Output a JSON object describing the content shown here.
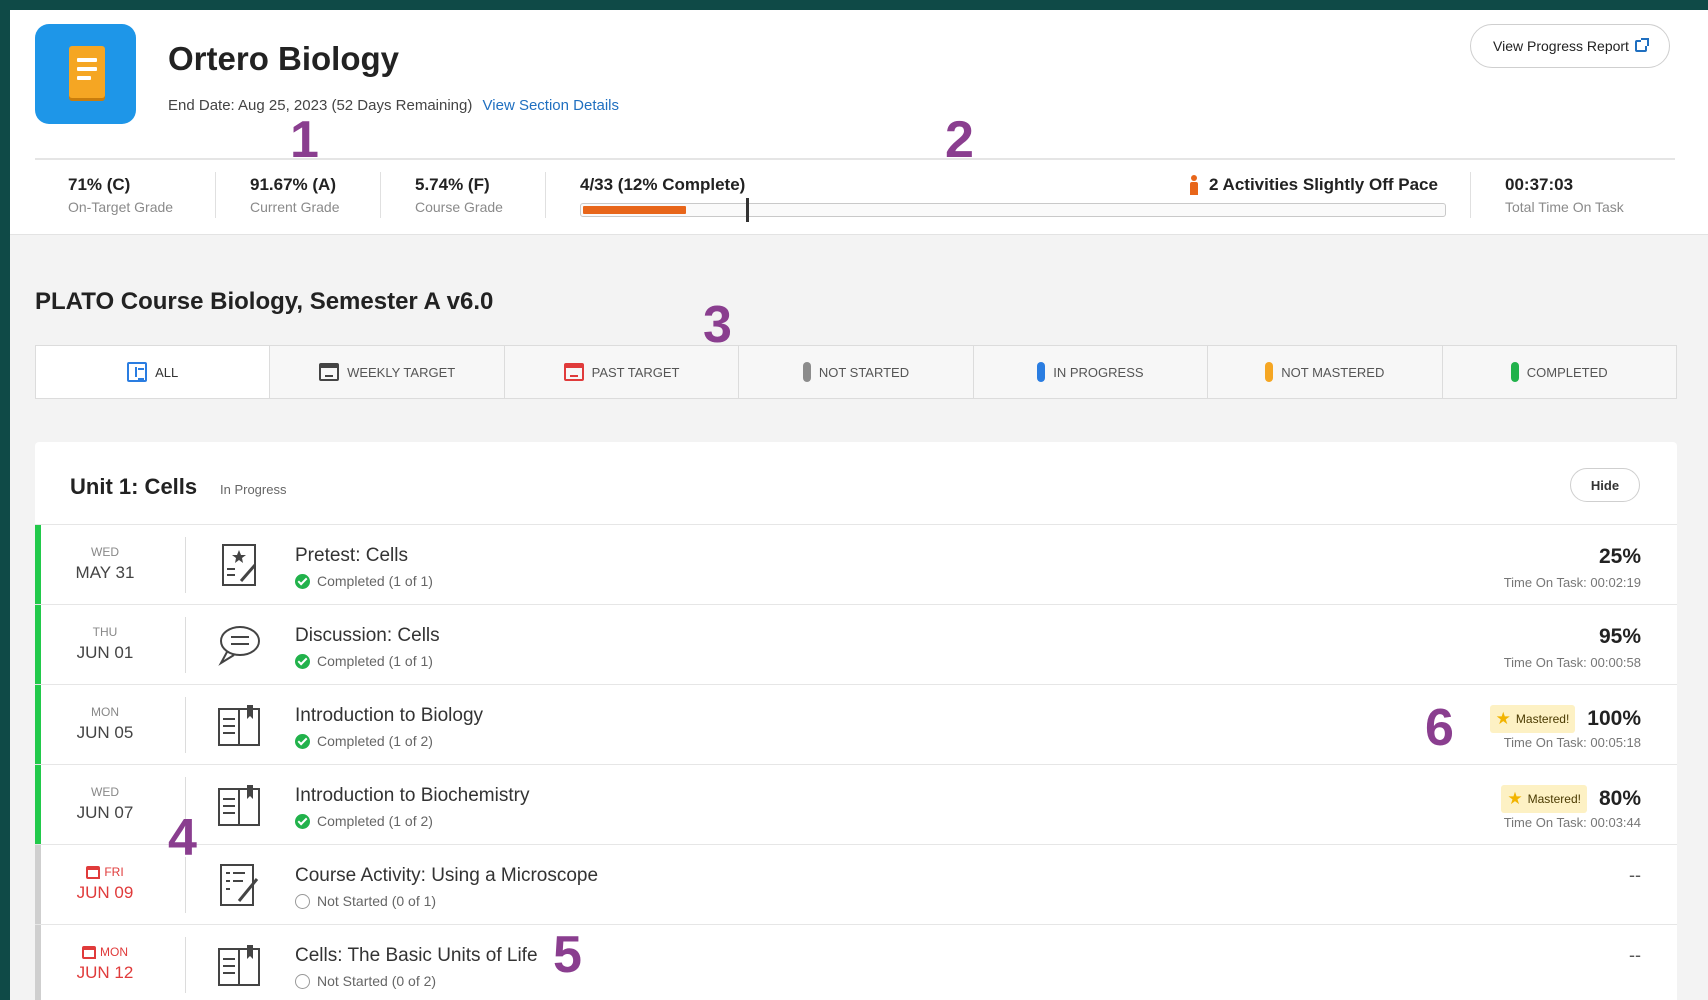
{
  "header": {
    "course_title": "Ortero Biology",
    "end_date_text": "End Date: Aug 25, 2023 (52 Days Remaining)",
    "view_section_details": "View Section Details",
    "view_progress_report": "View Progress Report",
    "stats": [
      {
        "value": "71% (C)",
        "label": "On-Target Grade"
      },
      {
        "value": "91.67% (A)",
        "label": "Current Grade"
      },
      {
        "value": "5.74% (F)",
        "label": "Course Grade"
      }
    ],
    "progress": {
      "label": "4/33 (12% Complete)",
      "fraction": 0.12,
      "target_fraction": 0.19
    },
    "pace_text": "2 Activities Slightly Off Pace",
    "time_on_task": {
      "value": "00:37:03",
      "label": "Total Time On Task"
    }
  },
  "section": {
    "title": "PLATO Course Biology, Semester A v6.0",
    "tabs": [
      {
        "label": "All",
        "icon": "list-icon"
      },
      {
        "label": "Weekly Target",
        "icon": "calendar-icon"
      },
      {
        "label": "Past Target",
        "icon": "calendar-alert-icon"
      },
      {
        "label": "Not Started",
        "color": "#8c8c8c"
      },
      {
        "label": "In Progress",
        "color": "#2a7de1"
      },
      {
        "label": "Not Mastered",
        "color": "#f5a623"
      },
      {
        "label": "Completed",
        "color": "#21b24b"
      }
    ]
  },
  "unit": {
    "title": "Unit 1: Cells",
    "status": "In Progress",
    "hide_label": "Hide",
    "activities": [
      {
        "dow": "WED",
        "date": "MAY 31",
        "name": "Pretest: Cells",
        "status": "Completed (1 of 1)",
        "score": "25%",
        "time": "Time On Task: 00:02:19",
        "icon": "quiz-icon"
      },
      {
        "dow": "THU",
        "date": "JUN 01",
        "name": "Discussion: Cells",
        "status": "Completed (1 of 1)",
        "score": "95%",
        "time": "Time On Task: 00:00:58",
        "icon": "discussion-icon"
      },
      {
        "dow": "MON",
        "date": "JUN 05",
        "name": "Introduction to Biology",
        "status": "Completed (1 of 2)",
        "score": "100%",
        "time": "Time On Task: 00:05:18",
        "badge": "Mastered!",
        "icon": "lesson-book-icon"
      },
      {
        "dow": "WED",
        "date": "JUN 07",
        "name": "Introduction to Biochemistry",
        "status": "Completed (1 of 2)",
        "score": "80%",
        "time": "Time On Task: 00:03:44",
        "badge": "Mastered!",
        "icon": "lesson-book-icon"
      },
      {
        "dow": "FRI",
        "date": "JUN 09",
        "name": "Course Activity: Using a Microscope",
        "status": "Not Started (0 of 1)",
        "score": "--",
        "icon": "activity-icon"
      },
      {
        "dow": "MON",
        "date": "JUN 12",
        "name": "Cells: The Basic Units of Life",
        "status": "Not Started (0 of 2)",
        "score": "--",
        "icon": "lesson-book-icon"
      }
    ]
  },
  "callouts": [
    "1",
    "2",
    "3",
    "4",
    "5",
    "6"
  ],
  "colors": {
    "accent_blue": "#1e96e8",
    "orange": "#e8661a",
    "green": "#21b24b",
    "red": "#e03b3b",
    "annotation_purple": "#8a3e8f"
  }
}
